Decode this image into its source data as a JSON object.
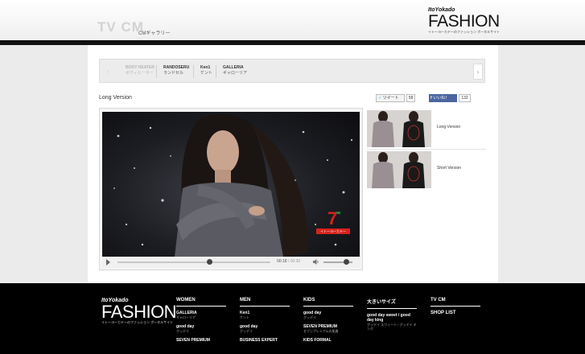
{
  "header": {
    "title": "TV CM",
    "subtitle": "CMギャラリー",
    "logo": {
      "top": "ItoYokado",
      "main": "FASHION",
      "tagline": "イトーヨーカドーのファッション ポータルサイト"
    }
  },
  "nav": {
    "items": [
      {
        "en": "BODY HEATER",
        "ja": "ボディヒーター",
        "dim": true
      },
      {
        "en": "RANDOSERU",
        "ja": "ランドセル"
      },
      {
        "en": "Ken1",
        "ja": "ケント"
      },
      {
        "en": "GALLERIA",
        "ja": "ギャローリア"
      }
    ],
    "prev_arrow": "‹",
    "next_arrow": "›"
  },
  "main": {
    "version_title": "Long Version",
    "social": {
      "tweet_label": "ツイート",
      "tweet_count": "58",
      "like_label": "いいね！",
      "like_count": "132"
    }
  },
  "player": {
    "current_time": "00:18",
    "separator": " / ",
    "duration": "00:30",
    "progress_fraction": 0.6,
    "volume_fraction": 0.8,
    "overlay_logo_text": "イトーヨーカドー"
  },
  "side_list": [
    {
      "label": "Long Version"
    },
    {
      "label": "Short Version"
    }
  ],
  "footer": {
    "logo": {
      "top": "ItoYokado",
      "main": "FASHION",
      "tagline": "イトーヨーカドーのファッション ポータルサイト"
    },
    "columns": [
      {
        "head": "WOMEN",
        "links": [
          {
            "en": "GALLERIA",
            "ja": "ギャローリア"
          },
          {
            "en": "good day",
            "ja": "グッデイ"
          },
          {
            "en": "SEVEN PREMIUM",
            "ja": ""
          }
        ]
      },
      {
        "head": "MEN",
        "links": [
          {
            "en": "Ken1",
            "ja": "ケント"
          },
          {
            "en": "good day",
            "ja": "グッデイ"
          },
          {
            "en": "BUSINESS EXPERT",
            "ja": ""
          }
        ]
      },
      {
        "head": "KIDS",
        "links": [
          {
            "en": "good day",
            "ja": "グッデイ"
          },
          {
            "en": "SEVEN PREMIUM",
            "ja": "セブンプレミアムの肌着"
          },
          {
            "en": "KIDS FORMAL",
            "ja": ""
          }
        ]
      },
      {
        "head": "大きいサイズ",
        "links": [
          {
            "en": "good day sweet / good day king",
            "ja": "グッデイ スウィート / グッデイ キング"
          }
        ]
      },
      {
        "head": "TV CM",
        "plain": "SHOP LIST"
      }
    ]
  },
  "colors": {
    "accent_blue": "#4a66a0",
    "twitter_blue": "#2aa9e0",
    "logo_red": "#d8221c",
    "logo_green": "#0b8a3a"
  }
}
